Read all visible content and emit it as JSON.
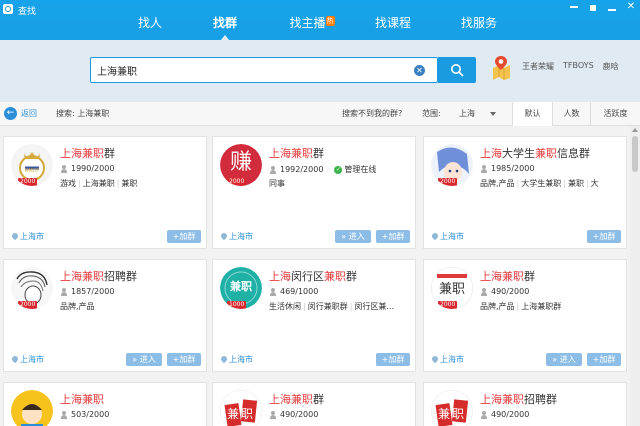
{
  "window": {
    "title": "查找"
  },
  "nav": {
    "tabs": [
      {
        "label": "找人",
        "active": false
      },
      {
        "label": "找群",
        "active": true
      },
      {
        "label": "找主播",
        "badge": "热",
        "active": false
      },
      {
        "label": "找课程",
        "active": false
      },
      {
        "label": "找服务",
        "active": false
      }
    ]
  },
  "search": {
    "value": "上海兼职",
    "hot_words": [
      "王者荣耀",
      "TFBOYS",
      "鹿晗"
    ]
  },
  "filter": {
    "back_label": "返回",
    "search_context": "搜索: 上海兼职",
    "not_found": "搜索不到我的群?",
    "range_label": "范围:",
    "range_value": "上海",
    "sort_tabs": [
      {
        "label": "默认",
        "active": true
      },
      {
        "label": "人数",
        "active": false
      },
      {
        "label": "活跃度",
        "active": false
      }
    ]
  },
  "results": [
    {
      "name_hl": "上海兼职",
      "name_rest": "群",
      "members": "1990/2000",
      "tags": [
        "游戏",
        "上海兼职",
        "兼职"
      ],
      "location": "上海市",
      "enter": false,
      "avatar": "real-madrid-logo",
      "level": "2000"
    },
    {
      "name_hl": "上海兼职",
      "name_rest": "群",
      "members": "1992/2000",
      "manager": "管理在线",
      "tags": [
        "同事"
      ],
      "location": "上海市",
      "enter": true,
      "avatar": "zhuan-character",
      "avatar_text": "赚",
      "level": "2000"
    },
    {
      "name_hl": "上海",
      "name_mid": "大学生",
      "name_hl2": "兼职",
      "name_rest": "信息群",
      "members": "1985/2000",
      "tags": [
        "品牌,产品",
        "大学生兼职",
        "兼职",
        "大"
      ],
      "location": "上海市",
      "enter": false,
      "avatar": "anime-girl",
      "level": "2000"
    },
    {
      "name_hl": "上海兼职",
      "name_rest": "招聘群",
      "members": "1857/2000",
      "tags": [
        "品牌,产品"
      ],
      "location": "上海市",
      "enter": true,
      "avatar": "sketch-portrait",
      "level": "2000"
    },
    {
      "name_hl": "上海",
      "name_mid": "闵行区",
      "name_hl2": "兼职",
      "name_rest": "群",
      "members": "469/1000",
      "tags": [
        "生活休闲",
        "闵行兼职群",
        "闵行区兼..."
      ],
      "location": "上海市",
      "enter": false,
      "avatar": "jianzhi-teal",
      "avatar_text": "兼职",
      "level": "1000"
    },
    {
      "name_hl": "上海兼职",
      "name_rest": "群",
      "members": "490/2000",
      "tags": [
        "品牌,产品",
        "上海兼职群"
      ],
      "location": "上海市",
      "enter": true,
      "avatar": "jianzhi-red",
      "avatar_text": "兼职",
      "level": "2000"
    },
    {
      "name_hl": "上海兼职",
      "name_rest": "",
      "members": "503/2000",
      "avatar": "yellow-cartoon"
    },
    {
      "name_hl": "上海兼职",
      "name_rest": "群",
      "members": "490/2000",
      "avatar": "jianzhi-calligraphy",
      "avatar_text": "兼职"
    },
    {
      "name_hl": "上海兼职",
      "name_rest": "招聘群",
      "members": "490/2000",
      "avatar": "jianzhi-calligraphy",
      "avatar_text": "兼职"
    }
  ],
  "buttons": {
    "join": "+加群",
    "enter": "» 进入"
  },
  "colors": {
    "accent": "#1a9ae0",
    "highlight": "#e63b3b",
    "badge": "#d9272e"
  }
}
